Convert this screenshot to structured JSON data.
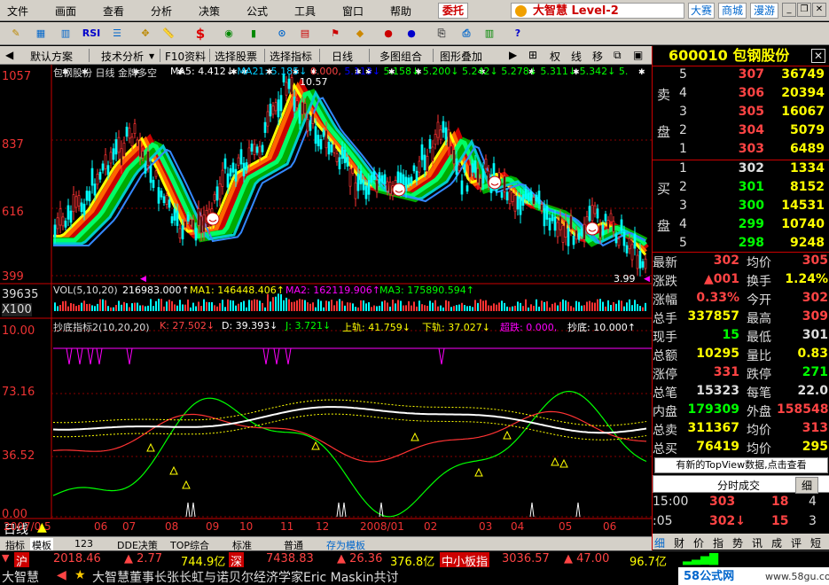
{
  "menu": {
    "items": [
      "文件",
      "画面",
      "查看",
      "分析",
      "决策",
      "公式",
      "工具",
      "窗口",
      "帮助"
    ],
    "entrust": "委托",
    "brand": "大智慧 Level-2",
    "contest": "大赛",
    "mall": "商城",
    "roam": "漫游"
  },
  "toolbar": {
    "rsi": "RSI",
    "dollar": "$"
  },
  "tabs": {
    "items": [
      "默认方案",
      "技术分析",
      "F10资料",
      "选择股票",
      "选择指标",
      "日线",
      "多图组合",
      "图形叠加"
    ],
    "right": [
      "⊞",
      "权",
      "线",
      "移",
      "⧉",
      "▣"
    ]
  },
  "main": {
    "caption": "包钢股份 日线 金牌多空",
    "ma": [
      {
        "t": "MA5: 4.412↓",
        "c": "#fff"
      },
      {
        "t": "MA21: 5.185↓",
        "c": "#0cf"
      },
      {
        "t": "0.000,",
        "c": "#f44"
      },
      {
        "t": "5.113↓",
        "c": "#00f"
      },
      {
        "t": "5.158↓",
        "c": "#0f0"
      },
      {
        "t": "5.200↓",
        "c": "#0f0"
      },
      {
        "t": "5.242↓",
        "c": "#0f0"
      },
      {
        "t": "5.278↓",
        "c": "#0f0"
      },
      {
        "t": "5.311↓",
        "c": "#0f0"
      },
      {
        "t": "5.342↓",
        "c": "#0f0"
      },
      {
        "t": "5.",
        "c": "#0f0"
      }
    ],
    "y_labels": [
      "1057",
      "837",
      "616",
      "399"
    ],
    "peak_label": "10.57",
    "low_label": "3.99"
  },
  "volume": {
    "caption": "VOL(5,10,20)",
    "v": "216983.000↑",
    "ma1": "MA1: 146448.406↑",
    "ma2": "MA2: 162119.906↑",
    "ma3": "MA3: 175890.594↑",
    "y_labels": [
      "39635",
      "X100"
    ]
  },
  "indicator": {
    "caption": "抄底指标2(10,20,20)",
    "k": "K: 27.502↓",
    "d": "D: 39.393↓",
    "j": "J: 3.721↓",
    "upper": "上轨: 41.759↓",
    "lower": "下轨: 37.027↓",
    "oversold": "超跌: 0.000,",
    "bottom": "抄底: 10.000↑",
    "y_labels": [
      "10.00",
      "73.16",
      "36.52",
      "0.00"
    ]
  },
  "dates": [
    "2007/0",
    "5",
    "06",
    "07",
    "08",
    "09",
    "10",
    "11",
    "12",
    "2008/01",
    "02",
    "03",
    "04",
    "05",
    "06"
  ],
  "period_label": "日线",
  "bottom_tabs": [
    "指标",
    "模板",
    "123",
    "DDE决策",
    "TOP综合",
    "标准",
    "普通",
    "存为模板"
  ],
  "right": {
    "code": "600010",
    "name": "包钢股份",
    "sell_label": "卖",
    "buy_label": "买",
    "pan": "盘",
    "asks": [
      {
        "l": "5",
        "p": "307",
        "v": "36749"
      },
      {
        "l": "4",
        "p": "306",
        "v": "20394"
      },
      {
        "l": "3",
        "p": "305",
        "v": "16067"
      },
      {
        "l": "2",
        "p": "304",
        "v": "5079"
      },
      {
        "l": "1",
        "p": "303",
        "v": "6489"
      }
    ],
    "bids": [
      {
        "l": "1",
        "p": "302",
        "v": "1334"
      },
      {
        "l": "2",
        "p": "301",
        "v": "8152"
      },
      {
        "l": "3",
        "p": "300",
        "v": "14531"
      },
      {
        "l": "4",
        "p": "299",
        "v": "10740"
      },
      {
        "l": "5",
        "p": "298",
        "v": "9248"
      }
    ],
    "quotes": [
      {
        "k1": "最新",
        "v1": "302",
        "c1": "#f44",
        "k2": "均价",
        "v2": "305",
        "c2": "#f44"
      },
      {
        "k1": "涨跌",
        "v1": "▲001",
        "c1": "#f44",
        "k2": "换手",
        "v2": "1.24%",
        "c2": "#ff0"
      },
      {
        "k1": "涨幅",
        "v1": "0.33%",
        "c1": "#f44",
        "k2": "今开",
        "v2": "302",
        "c2": "#f44"
      },
      {
        "k1": "总手",
        "v1": "337857",
        "c1": "#ff0",
        "k2": "最高",
        "v2": "309",
        "c2": "#f44"
      },
      {
        "k1": "现手",
        "v1": "15",
        "c1": "#0f0",
        "k2": "最低",
        "v2": "301",
        "c2": "#ddd"
      },
      {
        "k1": "总额",
        "v1": "10295",
        "c1": "#ff0",
        "k2": "量比",
        "v2": "0.83",
        "c2": "#ff0"
      },
      {
        "k1": "涨停",
        "v1": "331",
        "c1": "#f44",
        "k2": "跌停",
        "v2": "271",
        "c2": "#0f0"
      },
      {
        "k1": "总笔",
        "v1": "15323",
        "c1": "#ddd",
        "k2": "每笔",
        "v2": "22.0",
        "c2": "#ddd"
      },
      {
        "k1": "内盘",
        "v1": "179309",
        "c1": "#0f0",
        "k2": "外盘",
        "v2": "158548",
        "c2": "#f44"
      },
      {
        "k1": "总卖",
        "v1": "311367",
        "c1": "#ff0",
        "k2": "均价",
        "v2": "313",
        "c2": "#f44"
      },
      {
        "k1": "总买",
        "v1": "76419",
        "c1": "#ff0",
        "k2": "均价",
        "v2": "295",
        "c2": "#ff0"
      }
    ],
    "notice": "有新的TopView数据,点击查看",
    "tick_header": "分时成交",
    "tick_btn": "细",
    "ticks": [
      {
        "t": "15:00",
        "p": "303",
        "v": "18",
        "n": "4",
        "pc": "#f44",
        "vc": "#f44"
      },
      {
        "t": ":05",
        "p": "302↓",
        "v": "15",
        "n": "3",
        "pc": "#f44",
        "vc": "#f44"
      }
    ],
    "rtabs": [
      "细",
      "财",
      "价",
      "指",
      "势",
      "讯",
      "成",
      "评",
      "短"
    ]
  },
  "status": {
    "sh": "沪",
    "sh_index": "2018.46",
    "sh_chg": "▲ 2.77",
    "sh_amt": "744.9亿",
    "sz": "深",
    "sz_index": "7438.83",
    "sz_chg": "▲ 26.36",
    "sz_amt": "376.8亿",
    "sme": "中小板指",
    "sme_index": "3036.57",
    "sme_chg": "▲ 47.00",
    "sme_amt": "96.7亿"
  },
  "ticker": {
    "app": "大智慧",
    "news": "大智慧董事长张长虹与诺贝尔经济学家Eric Maskin共讨",
    "wm": "58公式网",
    "wm_url": "www.58gu.com"
  }
}
